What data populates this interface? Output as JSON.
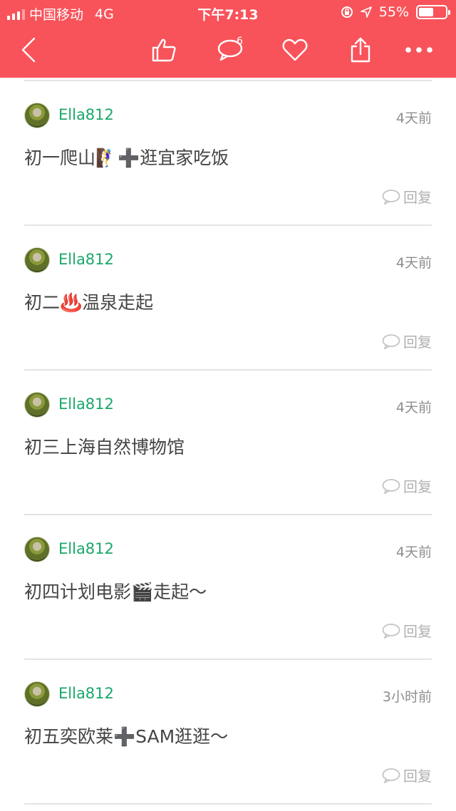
{
  "status_bar": {
    "carrier": "中国移动",
    "network": "4G",
    "time": "下午7:13",
    "battery": "55%",
    "battery_level": 0.55
  },
  "navbar": {
    "back_icon": "chevron-left-icon",
    "like_icon": "thumbs-up-icon",
    "comment_icon": "comment-icon",
    "comment_count": "6",
    "favorite_icon": "heart-icon",
    "share_icon": "share-icon",
    "more_icon": "more-dots-icon",
    "accent_color": "#f8535a"
  },
  "comments": [
    {
      "user": "Ella812",
      "time": "4天前",
      "content": "初一爬山🧗‍♀️➕逛宜家吃饭",
      "reply": "回复"
    },
    {
      "user": "Ella812",
      "time": "4天前",
      "content": "初二♨️温泉走起",
      "reply": "回复"
    },
    {
      "user": "Ella812",
      "time": "4天前",
      "content": "初三上海自然博物馆",
      "reply": "回复"
    },
    {
      "user": "Ella812",
      "time": "4天前",
      "content": "初四计划电影🎬走起～",
      "reply": "回复"
    },
    {
      "user": "Ella812",
      "time": "3小时前",
      "content": "初五奕欧莱➕SAM逛逛～",
      "reply": "回复"
    }
  ]
}
